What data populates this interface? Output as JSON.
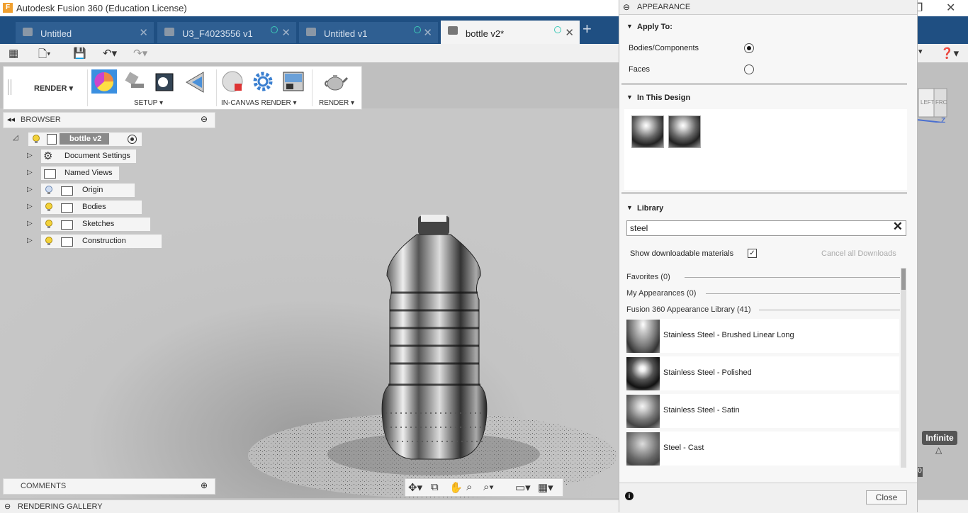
{
  "window": {
    "title": "Autodesk Fusion 360 (Education License)"
  },
  "tabs": [
    {
      "label": "Untitled",
      "active": false,
      "dot": false
    },
    {
      "label": "U3_F4023556 v1",
      "active": false,
      "dot": true
    },
    {
      "label": "Untitled v1",
      "active": false,
      "dot": true
    },
    {
      "label": "bottle v2*",
      "active": true,
      "dot": true
    }
  ],
  "ribbon": {
    "workspace": "RENDER",
    "groups": {
      "setup": "SETUP",
      "in_canvas": "IN-CANVAS RENDER",
      "render": "RENDER"
    }
  },
  "browser": {
    "title": "BROWSER",
    "root": "bottle v2",
    "items": [
      {
        "label": "Document Settings"
      },
      {
        "label": "Named Views"
      },
      {
        "label": "Origin"
      },
      {
        "label": "Bodies"
      },
      {
        "label": "Sketches"
      },
      {
        "label": "Construction"
      }
    ]
  },
  "comments": {
    "title": "COMMENTS"
  },
  "gallery": {
    "title": "RENDERING GALLERY"
  },
  "canvas": {
    "infinite": "Infinite",
    "viewcube_left": "LEFT",
    "viewcube_front": "FRONT",
    "axis_z": "Z",
    "counter": "0"
  },
  "appearance": {
    "title": "APPEARANCE",
    "apply_to": {
      "title": "Apply To:",
      "options": [
        {
          "label": "Bodies/Components",
          "selected": true
        },
        {
          "label": "Faces",
          "selected": false
        }
      ]
    },
    "in_this_design": {
      "title": "In This Design"
    },
    "library": {
      "title": "Library",
      "search_value": "steel",
      "show_downloadable": "Show downloadable materials",
      "show_downloadable_checked": true,
      "cancel_downloads": "Cancel all Downloads",
      "sections": {
        "favorites": "Favorites (0)",
        "my_appearances": "My Appearances (0)",
        "fusion_library": "Fusion 360 Appearance Library (41)"
      },
      "materials": [
        {
          "name": "Stainless Steel - Brushed Linear Long"
        },
        {
          "name": "Stainless Steel - Polished"
        },
        {
          "name": "Stainless Steel - Satin"
        },
        {
          "name": "Steel - Cast"
        }
      ]
    },
    "close_label": "Close"
  }
}
